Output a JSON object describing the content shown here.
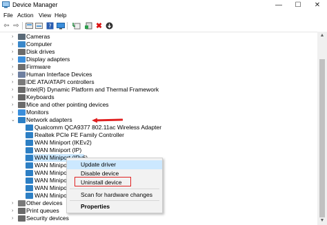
{
  "window": {
    "title": "Device Manager",
    "controls": [
      "—",
      "☐",
      "✕"
    ]
  },
  "menu": [
    "File",
    "Action",
    "View",
    "Help"
  ],
  "toolbar": [
    "back-icon",
    "forward-icon",
    "device-view-icon",
    "device-view-alt-icon",
    "help-icon",
    "monitor-icon",
    "scan-hardware-icon",
    "uninstall-icon",
    "update-driver-icon"
  ],
  "tree": [
    {
      "label": "Cameras",
      "icon": "camera-icon",
      "color": "#5a6a78"
    },
    {
      "label": "Computer",
      "icon": "computer-icon",
      "color": "#3a87c9"
    },
    {
      "label": "Disk drives",
      "icon": "disk-drive-icon",
      "color": "#6b6b6b"
    },
    {
      "label": "Display adapters",
      "icon": "display-adapter-icon",
      "color": "#3b8edb"
    },
    {
      "label": "Firmware",
      "icon": "firmware-icon",
      "color": "#6e6e6e"
    },
    {
      "label": "Human Interface Devices",
      "icon": "hid-icon",
      "color": "#6e7fa0"
    },
    {
      "label": "IDE ATA/ATAPI controllers",
      "icon": "ide-controller-icon",
      "color": "#7a7a7a"
    },
    {
      "label": "Intel(R) Dynamic Platform and Thermal Framework",
      "icon": "chip-icon",
      "color": "#6a6a6a"
    },
    {
      "label": "Keyboards",
      "icon": "keyboard-icon",
      "color": "#666666"
    },
    {
      "label": "Mice and other pointing devices",
      "icon": "mouse-icon",
      "color": "#6c6c6c"
    },
    {
      "label": "Monitors",
      "icon": "monitor-icon",
      "color": "#3b8edb"
    },
    {
      "label": "Network adapters",
      "icon": "network-adapter-icon",
      "color": "#2d7fc4"
    },
    {
      "label": "Qualcomm QCA9377 802.11ac Wireless Adapter",
      "icon": "network-adapter-icon",
      "color": "#2d7fc4"
    },
    {
      "label": "Realtek PCIe FE Family Controller",
      "icon": "network-adapter-icon",
      "color": "#2d7fc4"
    },
    {
      "label": "WAN Miniport (IKEv2)",
      "icon": "network-adapter-icon",
      "color": "#2d7fc4"
    },
    {
      "label": "WAN Miniport (IP)",
      "icon": "network-adapter-icon",
      "color": "#2d7fc4"
    },
    {
      "label": "WAN Miniport (IPv6)",
      "icon": "network-adapter-icon",
      "color": "#2d7fc4"
    },
    {
      "label": "WAN Miniport (L2TP)",
      "icon": "network-adapter-icon",
      "color": "#2d7fc4"
    },
    {
      "label": "WAN Miniport (Network Monitor)",
      "icon": "network-adapter-icon",
      "color": "#2d7fc4"
    },
    {
      "label": "WAN Miniport (PPPOE)",
      "icon": "network-adapter-icon",
      "color": "#2d7fc4"
    },
    {
      "label": "WAN Miniport (PPTP)",
      "icon": "network-adapter-icon",
      "color": "#2d7fc4"
    },
    {
      "label": "WAN Miniport (SSTP)",
      "icon": "network-adapter-icon",
      "color": "#2d7fc4"
    },
    {
      "label": "Other devices",
      "icon": "other-devices-icon",
      "color": "#7a7a7a"
    },
    {
      "label": "Print queues",
      "icon": "printer-icon",
      "color": "#6a6a6a"
    },
    {
      "label": "Security devices",
      "icon": "security-device-icon",
      "color": "#6a6a6a"
    }
  ],
  "context_menu": {
    "items": [
      "Update driver",
      "Disable device",
      "Uninstall device",
      "Scan for hardware changes",
      "Properties"
    ],
    "highlight_color": "#cce8ff",
    "annotation_color": "#e02020"
  }
}
